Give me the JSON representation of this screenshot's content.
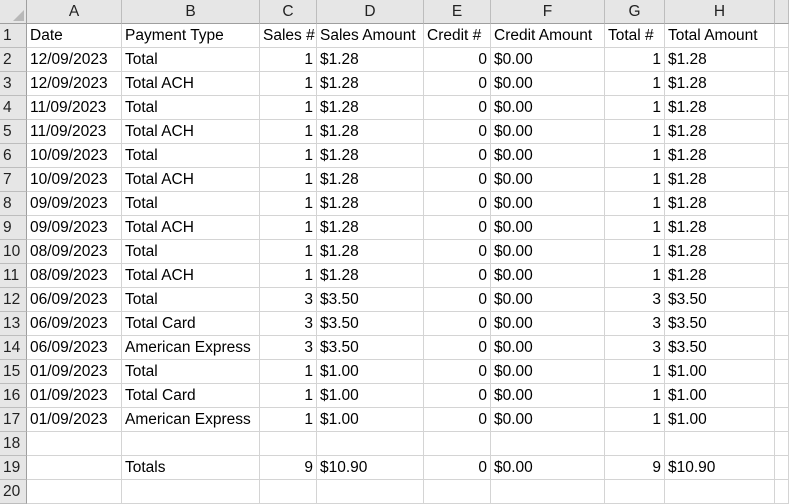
{
  "column_headers": [
    "A",
    "B",
    "C",
    "D",
    "E",
    "F",
    "G",
    "H"
  ],
  "rows": [
    {
      "n": "1",
      "cells": [
        "Date",
        "Payment Type",
        "Sales #",
        "Sales Amount",
        "Credit #",
        "Credit Amount",
        "Total #",
        "Total Amount"
      ]
    },
    {
      "n": "2",
      "cells": [
        "12/09/2023",
        "Total",
        "1",
        "$1.28",
        "0",
        "$0.00",
        "1",
        "$1.28"
      ]
    },
    {
      "n": "3",
      "cells": [
        "12/09/2023",
        "Total ACH",
        "1",
        "$1.28",
        "0",
        "$0.00",
        "1",
        "$1.28"
      ]
    },
    {
      "n": "4",
      "cells": [
        "11/09/2023",
        "Total",
        "1",
        "$1.28",
        "0",
        "$0.00",
        "1",
        "$1.28"
      ]
    },
    {
      "n": "5",
      "cells": [
        "11/09/2023",
        "Total ACH",
        "1",
        "$1.28",
        "0",
        "$0.00",
        "1",
        "$1.28"
      ]
    },
    {
      "n": "6",
      "cells": [
        "10/09/2023",
        "Total",
        "1",
        "$1.28",
        "0",
        "$0.00",
        "1",
        "$1.28"
      ]
    },
    {
      "n": "7",
      "cells": [
        "10/09/2023",
        "Total ACH",
        "1",
        "$1.28",
        "0",
        "$0.00",
        "1",
        "$1.28"
      ]
    },
    {
      "n": "8",
      "cells": [
        "09/09/2023",
        "Total",
        "1",
        "$1.28",
        "0",
        "$0.00",
        "1",
        "$1.28"
      ]
    },
    {
      "n": "9",
      "cells": [
        "09/09/2023",
        "Total ACH",
        "1",
        "$1.28",
        "0",
        "$0.00",
        "1",
        "$1.28"
      ]
    },
    {
      "n": "10",
      "cells": [
        "08/09/2023",
        "Total",
        "1",
        "$1.28",
        "0",
        "$0.00",
        "1",
        "$1.28"
      ]
    },
    {
      "n": "11",
      "cells": [
        "08/09/2023",
        "Total ACH",
        "1",
        "$1.28",
        "0",
        "$0.00",
        "1",
        "$1.28"
      ]
    },
    {
      "n": "12",
      "cells": [
        "06/09/2023",
        "Total",
        "3",
        "$3.50",
        "0",
        "$0.00",
        "3",
        "$3.50"
      ]
    },
    {
      "n": "13",
      "cells": [
        "06/09/2023",
        "Total Card",
        "3",
        "$3.50",
        "0",
        "$0.00",
        "3",
        "$3.50"
      ]
    },
    {
      "n": "14",
      "cells": [
        "06/09/2023",
        "American Express",
        "3",
        "$3.50",
        "0",
        "$0.00",
        "3",
        "$3.50"
      ]
    },
    {
      "n": "15",
      "cells": [
        "01/09/2023",
        "Total",
        "1",
        "$1.00",
        "0",
        "$0.00",
        "1",
        "$1.00"
      ]
    },
    {
      "n": "16",
      "cells": [
        "01/09/2023",
        "Total Card",
        "1",
        "$1.00",
        "0",
        "$0.00",
        "1",
        "$1.00"
      ]
    },
    {
      "n": "17",
      "cells": [
        "01/09/2023",
        "American Express",
        "1",
        "$1.00",
        "0",
        "$0.00",
        "1",
        "$1.00"
      ]
    },
    {
      "n": "18",
      "cells": [
        "",
        "",
        "",
        "",
        "",
        "",
        "",
        ""
      ]
    },
    {
      "n": "19",
      "cells": [
        "",
        "Totals",
        "9",
        "$10.90",
        "0",
        "$0.00",
        "9",
        "$10.90"
      ]
    },
    {
      "n": "20",
      "cells": [
        "",
        "",
        "",
        "",
        "",
        "",
        "",
        ""
      ]
    }
  ],
  "right_aligned_columns": [
    2,
    4,
    6
  ]
}
